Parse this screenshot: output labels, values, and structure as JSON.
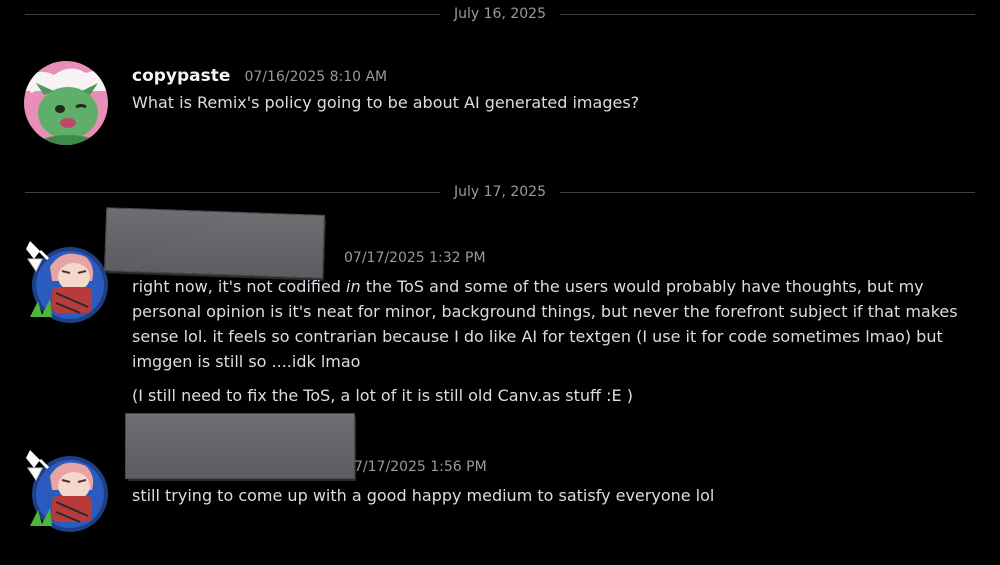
{
  "dividers": {
    "first": "July 16, 2025",
    "second": "July 17, 2025"
  },
  "messages": [
    {
      "author": "copypaste",
      "timestamp": "07/16/2025 8:10 AM",
      "text": "What is Remix's policy going to be about AI generated images?"
    },
    {
      "author": "",
      "timestamp": "07/17/2025 1:32 PM",
      "text_before": "right now, it's not codified ",
      "text_em": "in",
      "text_after": " the ToS and some of the users would probably have thoughts, but my personal opinion is it's neat for minor, background things, but never the forefront subject if that makes sense lol. it feels so contrarian because I do like AI for textgen (I use it for code sometimes lmao) but imggen is still so ....idk lmao",
      "followup": "(I still need to fix the ToS, a lot of it is still old Canv.as stuff :E )"
    },
    {
      "author": "",
      "timestamp": "7/17/2025 1:56 PM",
      "text": "still trying to come up with a good happy medium to satisfy everyone lol"
    }
  ],
  "colors": {
    "background": "#000000",
    "divider_line": "#3f4147",
    "muted_text": "#949ba4",
    "body_text": "#dbdee1",
    "author_text": "#f2f3f5",
    "redaction": "#636366"
  }
}
